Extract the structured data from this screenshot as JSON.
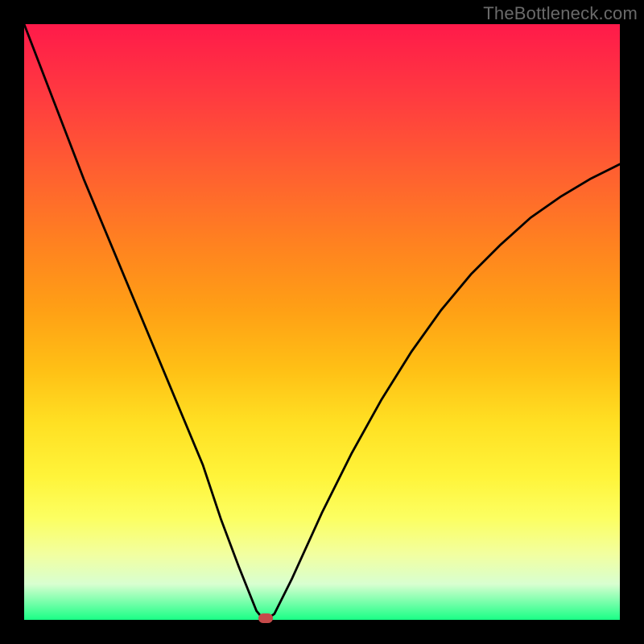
{
  "watermark": "TheBottleneck.com",
  "chart_data": {
    "type": "line",
    "title": "",
    "xlabel": "",
    "ylabel": "",
    "xlim": [
      0,
      100
    ],
    "ylim": [
      0,
      100
    ],
    "series": [
      {
        "name": "bottleneck-curve",
        "x": [
          0,
          5,
          10,
          15,
          20,
          25,
          30,
          33,
          36,
          38,
          39,
          40,
          41,
          42,
          45,
          50,
          55,
          60,
          65,
          70,
          75,
          80,
          85,
          90,
          95,
          100
        ],
        "values": [
          100,
          87,
          74,
          62,
          50,
          38,
          26,
          17,
          9,
          4,
          1.5,
          0.3,
          0.3,
          1,
          7,
          18,
          28,
          37,
          45,
          52,
          58,
          63,
          67.5,
          71,
          74,
          76.5
        ]
      }
    ],
    "marker": {
      "x": 40.5,
      "y": 0.3,
      "color": "#c54a4a"
    },
    "background_gradient": {
      "top": "#ff1a4a",
      "bottom": "#1aff86"
    }
  }
}
